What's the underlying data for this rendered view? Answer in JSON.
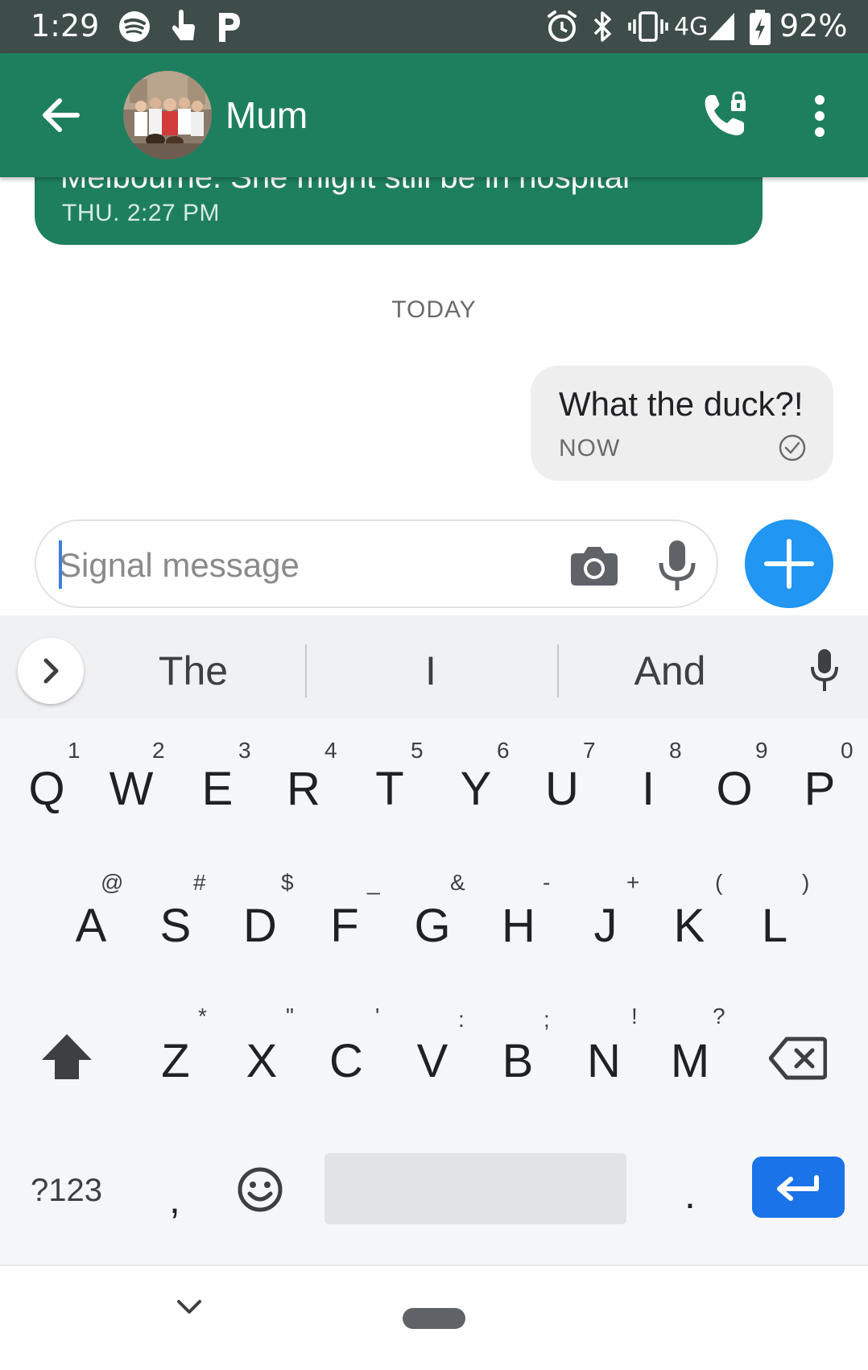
{
  "status_bar": {
    "time": "1:29",
    "network": "4G",
    "battery": "92%"
  },
  "header": {
    "contact_name": "Mum",
    "icons": [
      "back-arrow-icon",
      "contact-avatar",
      "secure-call-icon",
      "more-vert-icon"
    ]
  },
  "conversation": {
    "incoming": {
      "clipped_text": "Melbourne. She might still be in hospital",
      "timestamp": "THU. 2:27 PM"
    },
    "date_divider": "TODAY",
    "outgoing": {
      "text": "What the duck?!",
      "timestamp": "NOW",
      "status_icon": "delivered-check-icon"
    }
  },
  "composer": {
    "placeholder": "Signal message",
    "value": "",
    "accent_color": "#2196f3"
  },
  "keyboard": {
    "suggestions": [
      "The",
      "I",
      "And"
    ],
    "row1": [
      {
        "key": "Q",
        "hint": "1"
      },
      {
        "key": "W",
        "hint": "2"
      },
      {
        "key": "E",
        "hint": "3"
      },
      {
        "key": "R",
        "hint": "4"
      },
      {
        "key": "T",
        "hint": "5"
      },
      {
        "key": "Y",
        "hint": "6"
      },
      {
        "key": "U",
        "hint": "7"
      },
      {
        "key": "I",
        "hint": "8"
      },
      {
        "key": "O",
        "hint": "9"
      },
      {
        "key": "P",
        "hint": "0"
      }
    ],
    "row2": [
      {
        "key": "A",
        "hint": "@"
      },
      {
        "key": "S",
        "hint": "#"
      },
      {
        "key": "D",
        "hint": "$"
      },
      {
        "key": "F",
        "hint": "_"
      },
      {
        "key": "G",
        "hint": "&"
      },
      {
        "key": "H",
        "hint": "-"
      },
      {
        "key": "J",
        "hint": "+"
      },
      {
        "key": "K",
        "hint": "("
      },
      {
        "key": "L",
        "hint": ")"
      }
    ],
    "row3": [
      {
        "key": "Z",
        "hint": "*"
      },
      {
        "key": "X",
        "hint": "\""
      },
      {
        "key": "C",
        "hint": "'"
      },
      {
        "key": "V",
        "hint": ":"
      },
      {
        "key": "B",
        "hint": ";"
      },
      {
        "key": "N",
        "hint": "!"
      },
      {
        "key": "M",
        "hint": "?"
      }
    ],
    "symbols_label": "?123",
    "comma": ",",
    "period": ".",
    "enter_color": "#1a73e8"
  },
  "colors": {
    "app_bar": "#1e7f5e",
    "status_bar": "#3e4d49",
    "outgoing_bubble": "#eeeeee"
  }
}
